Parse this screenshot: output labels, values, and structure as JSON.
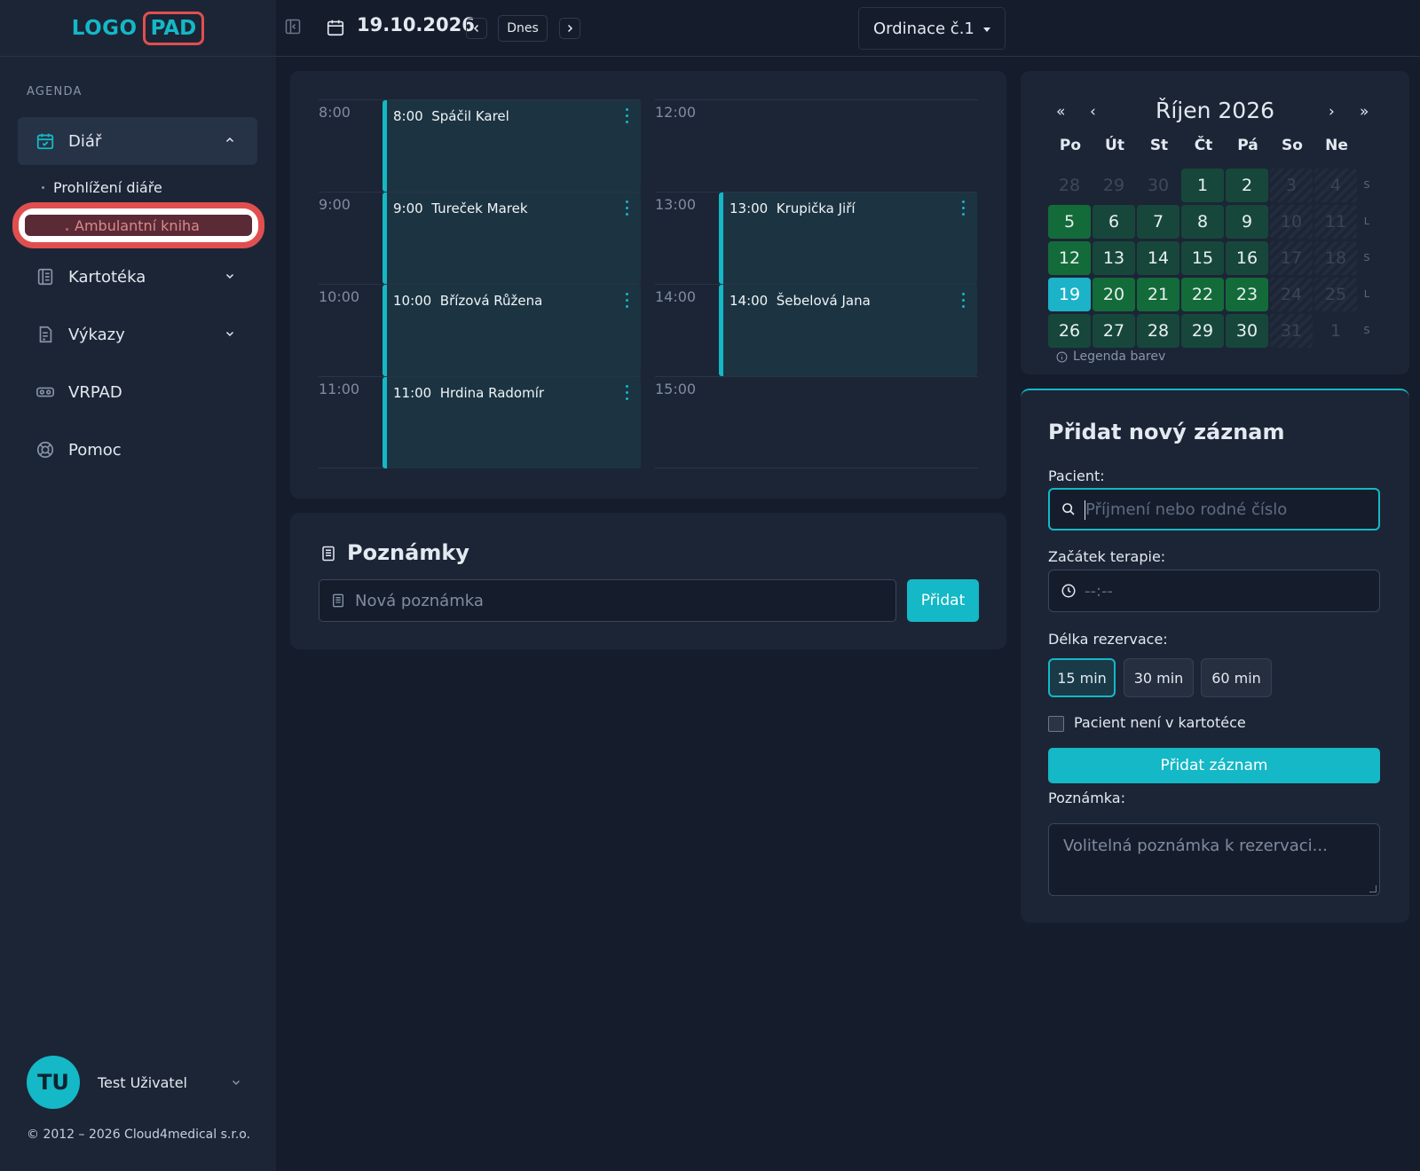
{
  "logo": {
    "part1": "LOGO",
    "part2": "PAD"
  },
  "sidebar": {
    "section": "AGENDA",
    "diar": {
      "label": "Diář",
      "sub": [
        "Prohlížení diáře",
        "Ambulantní kniha"
      ]
    },
    "items": [
      {
        "label": "Kartotéka",
        "icon": "book-icon"
      },
      {
        "label": "Výkazy",
        "icon": "report-icon"
      },
      {
        "label": "VRPAD",
        "icon": "vr-headset-icon"
      },
      {
        "label": "Pomoc",
        "icon": "lifebuoy-icon"
      }
    ],
    "user": {
      "initials": "TU",
      "name": "Test Uživatel"
    },
    "copyright": "© 2012 – 2026 Cloud4medical s.r.o."
  },
  "topbar": {
    "date": "19.10.2026",
    "today": "Dnes",
    "office": "Ordinace č.1"
  },
  "schedule": {
    "times_left": [
      "8:00",
      "9:00",
      "10:00",
      "11:00"
    ],
    "times_right": [
      "12:00",
      "13:00",
      "14:00",
      "15:00"
    ],
    "appointments_left": [
      {
        "time": "8:00",
        "name": "Spáčil Karel"
      },
      {
        "time": "9:00",
        "name": "Tureček Marek"
      },
      {
        "time": "10:00",
        "name": "Břízová Růžena"
      },
      {
        "time": "11:00",
        "name": "Hrdina Radomír"
      }
    ],
    "appointments_right": [
      {
        "time": "13:00",
        "name": "Krupička Jiří"
      },
      {
        "time": "14:00",
        "name": "Šebelová Jana"
      }
    ]
  },
  "notes": {
    "title": "Poznámky",
    "placeholder": "Nová poznámka",
    "button": "Přidat"
  },
  "calendar": {
    "nav": {
      "prev_year": "«",
      "prev": "‹",
      "next": "›",
      "next_year": "»"
    },
    "month": "Říjen 2026",
    "weekdays": [
      "Po",
      "Út",
      "St",
      "Čt",
      "Pá",
      "So",
      "Ne"
    ],
    "weeks": [
      {
        "days": [
          "28",
          "29",
          "30",
          "1",
          "2",
          "3",
          "4"
        ],
        "letter": "S"
      },
      {
        "days": [
          "5",
          "6",
          "7",
          "8",
          "9",
          "10",
          "11"
        ],
        "letter": "L"
      },
      {
        "days": [
          "12",
          "13",
          "14",
          "15",
          "16",
          "17",
          "18"
        ],
        "letter": "S"
      },
      {
        "days": [
          "19",
          "20",
          "21",
          "22",
          "23",
          "24",
          "25"
        ],
        "letter": "L"
      },
      {
        "days": [
          "26",
          "27",
          "28",
          "29",
          "30",
          "31",
          "1"
        ],
        "letter": "S"
      }
    ],
    "legend": "Legenda barev"
  },
  "add_record": {
    "title": "Přidat nový záznam",
    "patient_label": "Pacient:",
    "patient_placeholder": "Příjmení nebo rodné číslo",
    "start_label": "Začátek terapie:",
    "start_value": "--:--",
    "duration_label": "Délka rezervace:",
    "durations": [
      "15 min",
      "30 min",
      "60 min"
    ],
    "selected_duration": "15 min",
    "checkbox": "Pacient není v kartotéce",
    "submit": "Přidat záznam",
    "note_label": "Poznámka:",
    "note_placeholder": "Volitelná poznámka k rezervaci..."
  },
  "colors": {
    "accent": "#14b8c6",
    "highlight": "#e04f4f",
    "background": "#151d2c",
    "panel": "#1c2536"
  }
}
